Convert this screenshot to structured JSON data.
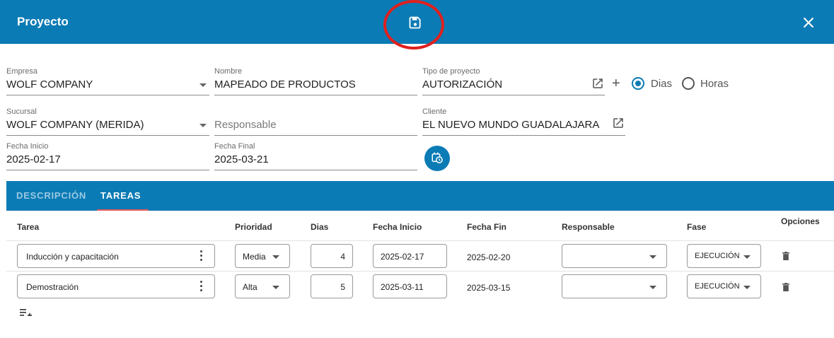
{
  "header": {
    "title": "Proyecto"
  },
  "form": {
    "empresa": {
      "label": "Empresa",
      "value": "WOLF COMPANY"
    },
    "nombre": {
      "label": "Nombre",
      "value": "MAPEADO DE PRODUCTOS"
    },
    "tipo": {
      "label": "Tipo de proyecto",
      "value": "AUTORIZACIÓN"
    },
    "radios": {
      "dias": "Dias",
      "horas": "Horas",
      "selected": "Dias"
    },
    "sucursal": {
      "label": "Sucursal",
      "value": "WOLF COMPANY (MERIDA)"
    },
    "responsable": {
      "placeholder": "Responsable"
    },
    "cliente": {
      "label": "Cliente",
      "value": "EL NUEVO MUNDO GUADALAJARA"
    },
    "fecha_inicio": {
      "label": "Fecha Inicio",
      "value": "2025-02-17"
    },
    "fecha_final": {
      "label": "Fecha Final",
      "value": "2025-03-21"
    }
  },
  "tabs": [
    {
      "label": "DESCRIPCIÓN",
      "active": false
    },
    {
      "label": "TAREAS",
      "active": true
    }
  ],
  "table": {
    "headers": [
      "Tarea",
      "Prioridad",
      "Dias",
      "Fecha Inicio",
      "Fecha Fin",
      "Responsable",
      "Fase",
      "Opciones"
    ],
    "rows": [
      {
        "tarea": "Inducción y capacitación",
        "prioridad": "Media",
        "dias": "4",
        "fecha_inicio": "2025-02-17",
        "fecha_fin": "2025-02-20",
        "responsable": "",
        "fase": "EJECUCIÓN"
      },
      {
        "tarea": "Demostración",
        "prioridad": "Alta",
        "dias": "5",
        "fecha_inicio": "2025-03-11",
        "fecha_fin": "2025-03-15",
        "responsable": "",
        "fase": "EJECUCIÓN"
      }
    ]
  },
  "icons": {
    "save": "save-icon",
    "close": "close-icon",
    "open_external": "open-in-new-icon",
    "add": "plus-icon",
    "calendar": "calendar-clock-icon",
    "delete": "trash-icon",
    "add_row": "playlist-add-icon"
  },
  "colors": {
    "primary": "#0b7bb5",
    "tab_indicator": "#e65b5b",
    "annotation": "#e0201e"
  }
}
